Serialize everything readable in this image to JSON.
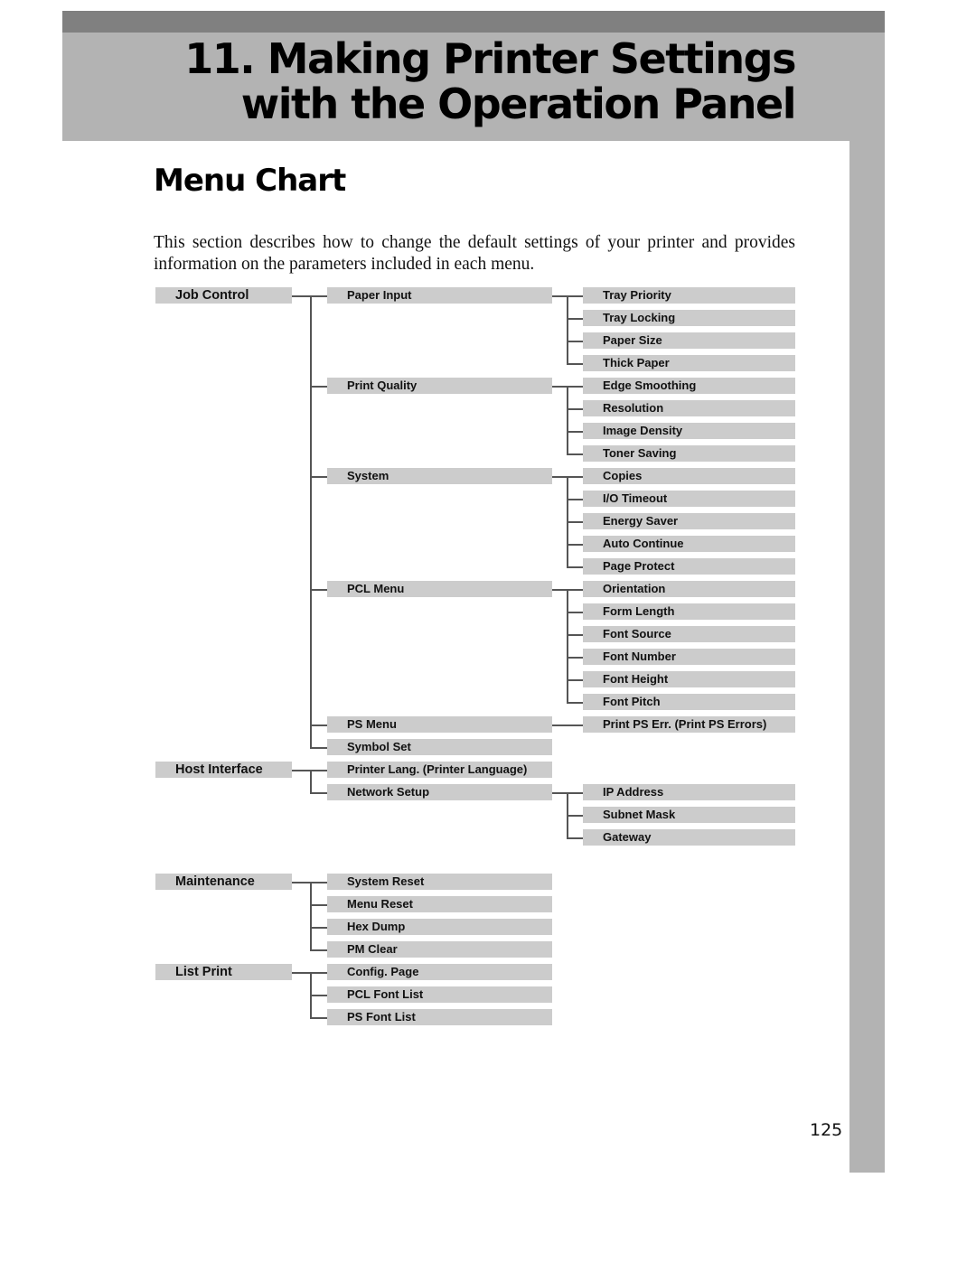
{
  "header": {
    "chapter_title_line1": "11. Making Printer Settings",
    "chapter_title_line2": "with the Operation Panel"
  },
  "section": {
    "title": "Menu Chart",
    "intro": "This section describes how to change the default settings of your printer and provides information on the parameters included in each menu."
  },
  "menu_tree": [
    {
      "label": "Job Control",
      "children": [
        {
          "label": "Paper Input",
          "children": [
            "Tray Priority",
            "Tray Locking",
            "Paper Size",
            "Thick Paper"
          ]
        },
        {
          "label": "Print Quality",
          "children": [
            "Edge Smoothing",
            "Resolution",
            "Image Density",
            "Toner Saving"
          ]
        },
        {
          "label": "System",
          "children": [
            "Copies",
            "I/O Timeout",
            "Energy Saver",
            "Auto Continue",
            "Page Protect"
          ]
        },
        {
          "label": "PCL Menu",
          "children": [
            "Orientation",
            "Form Length",
            "Font Source",
            "Font Number",
            "Font Height",
            "Font Pitch"
          ]
        },
        {
          "label": "PS Menu",
          "children": [
            "Print PS Err. (Print PS Errors)"
          ]
        },
        {
          "label": "Symbol Set",
          "children": []
        }
      ]
    },
    {
      "label": "Host Interface",
      "children": [
        {
          "label": "Printer Lang. (Printer Language)",
          "children": []
        },
        {
          "label": "Network Setup",
          "children": [
            "IP Address",
            "Subnet Mask",
            "Gateway"
          ]
        }
      ]
    },
    {
      "label": "Maintenance",
      "children": [
        {
          "label": "System Reset",
          "children": []
        },
        {
          "label": "Menu Reset",
          "children": []
        },
        {
          "label": "Hex Dump",
          "children": []
        },
        {
          "label": "PM Clear",
          "children": []
        }
      ]
    },
    {
      "label": "List Print",
      "children": [
        {
          "label": "Config. Page",
          "children": []
        },
        {
          "label": "PCL Font List",
          "children": []
        },
        {
          "label": "PS Font List",
          "children": []
        }
      ]
    }
  ],
  "footer": {
    "page_number": "125"
  }
}
